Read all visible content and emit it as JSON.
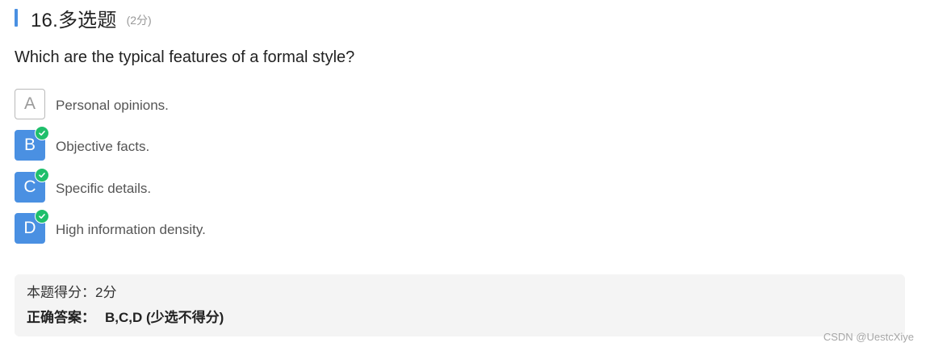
{
  "question": {
    "title": "16.多选题",
    "score": "(2分)",
    "stem": "Which are the typical features of a formal style?"
  },
  "options": [
    {
      "letter": "A",
      "text": "Personal opinions.",
      "selected": false
    },
    {
      "letter": "B",
      "text": "Objective facts.",
      "selected": true
    },
    {
      "letter": "C",
      "text": "Specific details.",
      "selected": true
    },
    {
      "letter": "D",
      "text": "High information density.",
      "selected": true
    }
  ],
  "result": {
    "score_line": "本题得分：2分",
    "answer_label": "正确答案：",
    "answer_value": "B,C,D (少选不得分)"
  },
  "watermark": "CSDN @UestcXiye",
  "colors": {
    "accent": "#4a90e2",
    "check": "#1fbf6b",
    "panel_bg": "#f4f4f4"
  },
  "icons": {
    "selected_badge": "check-circle-icon"
  }
}
